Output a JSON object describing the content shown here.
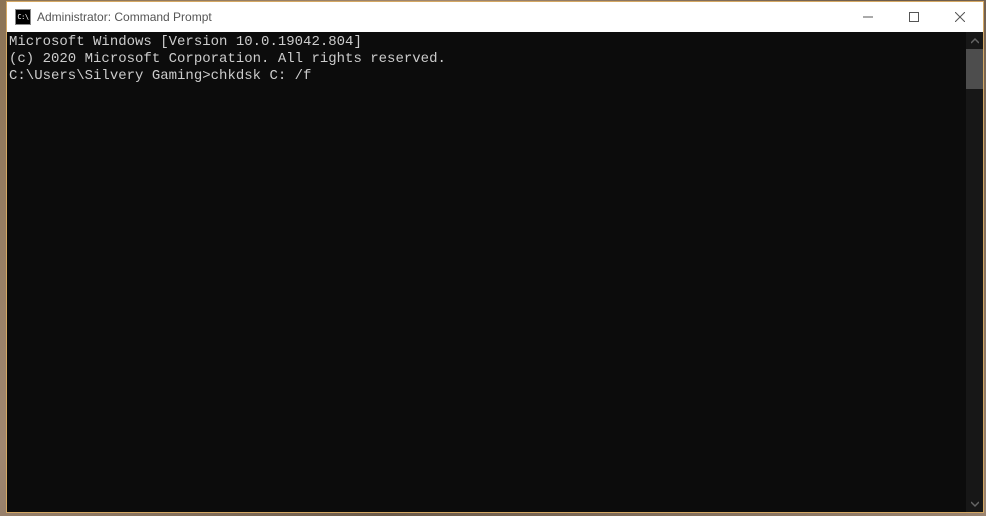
{
  "window": {
    "title": "Administrator: Command Prompt",
    "icon_label": "C:\\"
  },
  "terminal": {
    "line1": "Microsoft Windows [Version 10.0.19042.804]",
    "line2": "(c) 2020 Microsoft Corporation. All rights reserved.",
    "blank": "",
    "prompt": "C:\\Users\\Silvery Gaming>",
    "command": "chkdsk C: /f"
  }
}
